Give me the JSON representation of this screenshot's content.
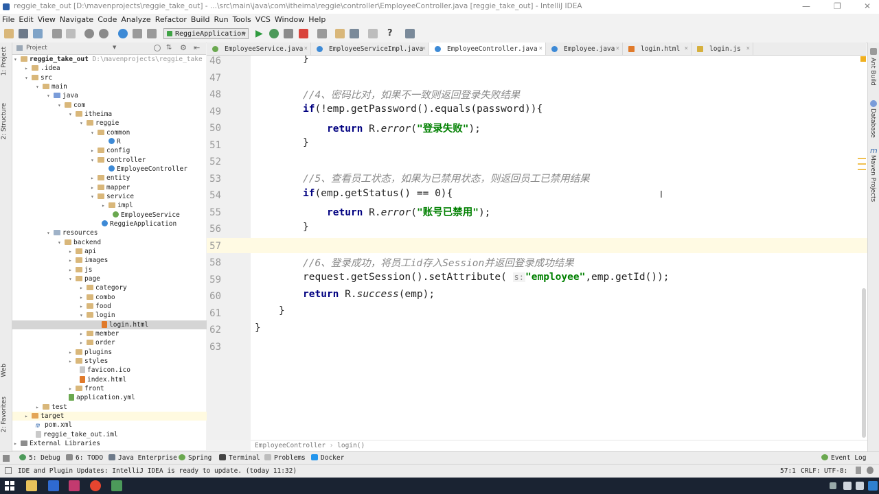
{
  "window": {
    "title": "reggie_take_out [D:\\mavenprojects\\reggie_take_out] - ...\\src\\main\\java\\com\\itheima\\reggie\\controller\\EmployeeController.java [reggie_take_out] - IntelliJ IDEA"
  },
  "menu": [
    "File",
    "Edit",
    "View",
    "Navigate",
    "Code",
    "Analyze",
    "Refactor",
    "Build",
    "Run",
    "Tools",
    "VCS",
    "Window",
    "Help"
  ],
  "toolbar": {
    "run_config": "ReggieApplication"
  },
  "sidebar": {
    "left_tabs": [
      "1: Project",
      "2: Structure",
      "Web",
      "2: Favorites"
    ],
    "right_tabs": [
      "Ant Build",
      "Database",
      "Maven Projects"
    ]
  },
  "project_panel": {
    "header": "Project",
    "root_name": "reggie_take_out",
    "root_path": "D:\\mavenprojects\\reggie_take",
    "items": [
      {
        "label": "reggie_take_out"
      },
      {
        "label": ".idea"
      },
      {
        "label": "src"
      },
      {
        "label": "main"
      },
      {
        "label": "java"
      },
      {
        "label": "com"
      },
      {
        "label": "itheima"
      },
      {
        "label": "reggie"
      },
      {
        "label": "common"
      },
      {
        "label": "R"
      },
      {
        "label": "config"
      },
      {
        "label": "controller"
      },
      {
        "label": "EmployeeController"
      },
      {
        "label": "entity"
      },
      {
        "label": "mapper"
      },
      {
        "label": "service"
      },
      {
        "label": "impl"
      },
      {
        "label": "EmployeeService"
      },
      {
        "label": "ReggieApplication"
      },
      {
        "label": "resources"
      },
      {
        "label": "backend"
      },
      {
        "label": "api"
      },
      {
        "label": "images"
      },
      {
        "label": "js"
      },
      {
        "label": "page"
      },
      {
        "label": "category"
      },
      {
        "label": "combo"
      },
      {
        "label": "food"
      },
      {
        "label": "login"
      },
      {
        "label": "login.html"
      },
      {
        "label": "member"
      },
      {
        "label": "order"
      },
      {
        "label": "plugins"
      },
      {
        "label": "styles"
      },
      {
        "label": "favicon.ico"
      },
      {
        "label": "index.html"
      },
      {
        "label": "front"
      },
      {
        "label": "application.yml"
      },
      {
        "label": "test"
      },
      {
        "label": "target"
      },
      {
        "label": "pom.xml"
      },
      {
        "label": "reggie_take_out.iml"
      },
      {
        "label": "External Libraries"
      }
    ]
  },
  "editor_tabs": [
    {
      "label": "EmployeeService.java"
    },
    {
      "label": "EmployeeServiceImpl.java"
    },
    {
      "label": "EmployeeController.java"
    },
    {
      "label": "Employee.java"
    },
    {
      "label": "login.html"
    },
    {
      "label": "login.js"
    }
  ],
  "code": {
    "line_numbers": [
      "46",
      "47",
      "48",
      "49",
      "50",
      "51",
      "52",
      "53",
      "54",
      "55",
      "56",
      "57",
      "58",
      "59",
      "60",
      "61",
      "62",
      "63"
    ],
    "l46": "}",
    "l48": "//4、密码比对，如果不一致则返回登录失败结果",
    "l49a": "if",
    "l49b": "(!emp.getPassword().equals(password)){",
    "l50a": "return",
    "l50b": " R.",
    "l50c": "error",
    "l50d": "(",
    "l50e": "\"登录失败\"",
    "l50f": ");",
    "l51": "}",
    "l53": "//5、查看员工状态，如果为已禁用状态，则返回员工已禁用结果",
    "l54a": "if",
    "l54b": "(emp.getStatus() == 0){",
    "l55a": "return",
    "l55b": " R.",
    "l55c": "error",
    "l55d": "(",
    "l55e": "\"账号已禁用\"",
    "l55f": ");",
    "l56": "}",
    "l58": "//6、登录成功，将员工id存入Session并返回登录成功结果",
    "l59a": "request.getSession().setAttribute(",
    "l59b": "s:",
    "l59c": "\"employee\"",
    "l59d": ",emp.getId());",
    "l60a": "return",
    "l60b": " R.",
    "l60c": "success",
    "l60d": "(emp);",
    "l61": "}",
    "l62": "}"
  },
  "breadcrumb": [
    "EmployeeController",
    "login()"
  ],
  "bottom_tools": [
    "5: Debug",
    "6: TODO",
    "Java Enterprise",
    "Spring",
    "Terminal",
    "Problems",
    "Docker",
    "Event Log"
  ],
  "status": {
    "message": "IDE and Plugin Updates: IntelliJ IDEA is ready to update. (today 11:32)",
    "position": "57:1",
    "line_sep": "CRLF:",
    "encoding": "UTF-8:"
  }
}
